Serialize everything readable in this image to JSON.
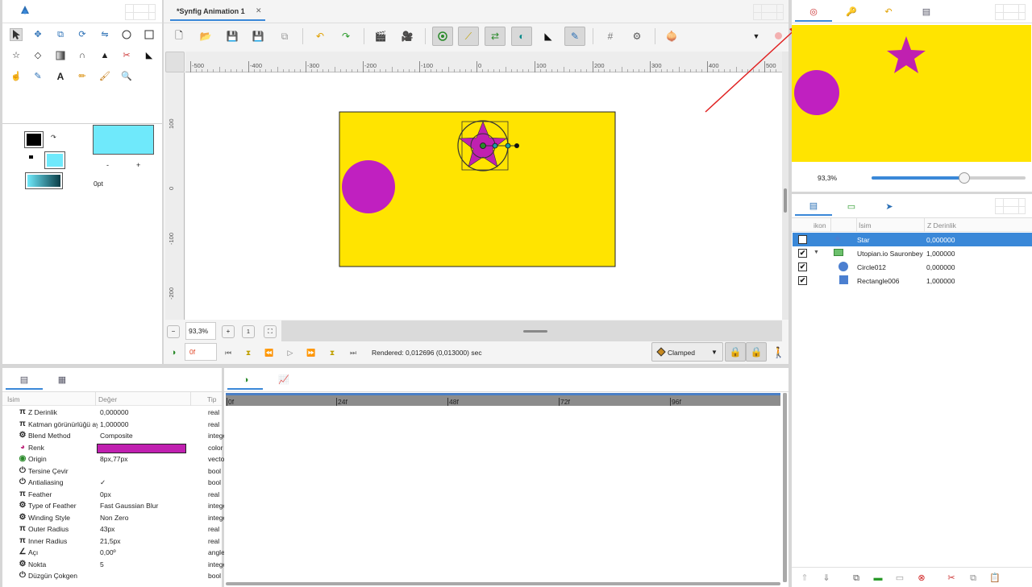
{
  "toolbox": {
    "tools": [
      "transform-tool",
      "smooth-move-tool",
      "scale-tool",
      "rotate-tool",
      "mirror-tool",
      "circle-tool",
      "rectangle-tool",
      "star-tool",
      "polygon-tool",
      "gradient-tool",
      "spline-tool",
      "fill-tool",
      "cutout-tool",
      "width-tool",
      "bone-tool",
      "eyedrop-tool",
      "text-tool",
      "sketch-tool",
      "brush-tool",
      "zoom-tool"
    ],
    "brush_size": "0pt",
    "outline_color": "#000000",
    "fill_color": "#6fe9fb",
    "minus": "-",
    "plus": "+"
  },
  "document": {
    "tab_title": "*Synfig Animation 1",
    "close_glyph": "✕"
  },
  "ruler": {
    "h_labels": [
      "-500",
      "-400",
      "-300",
      "-200",
      "-100",
      "0",
      "100",
      "200",
      "300",
      "400",
      "500"
    ],
    "v_labels": [
      "100",
      "0",
      "-100",
      "-200"
    ]
  },
  "canvas": {
    "background": "#ffe400",
    "circle_color": "#c020c0",
    "star_color": "#c020b0",
    "zoom": "93,3%"
  },
  "timebar": {
    "current_frame": "0f",
    "render_status": "Rendered: 0,012696 (0,013000) sec",
    "interpolation": "Clamped"
  },
  "navigator": {
    "zoom": "93,3%",
    "zoom_fraction": 0.6
  },
  "layers": {
    "headers": {
      "icon": "ikon",
      "name": "İsim",
      "zdepth": "Z Derinlik"
    },
    "rows": [
      {
        "name": "Star",
        "z": "0,000000",
        "checked": "✔",
        "selected": true
      },
      {
        "name": "Utopian.io Sauronbey",
        "z": "1,000000",
        "checked": "✔",
        "expander": "▼"
      },
      {
        "name": "Circle012",
        "z": "0,000000",
        "checked": "✔"
      },
      {
        "name": "Rectangle006",
        "z": "1,000000",
        "checked": "✔"
      }
    ]
  },
  "params": {
    "headers": {
      "name": "İsim",
      "value": "Değer",
      "type": "Tip"
    },
    "rows": [
      {
        "icon": "π",
        "name": "Z Derinlik",
        "value": "0,000000",
        "type": "real"
      },
      {
        "icon": "π",
        "name": "Katman görünürlüğü ay",
        "value": "1,000000",
        "type": "real"
      },
      {
        "icon": "⚙",
        "name": "Blend Method",
        "value": "Composite",
        "type": "intege"
      },
      {
        "icon": "◕",
        "name": "Renk",
        "value": "",
        "type": "color",
        "swatch": "#c020b0"
      },
      {
        "icon": "◉",
        "name": "Origin",
        "value": "8px,77px",
        "type": "vecto"
      },
      {
        "icon": "⏻",
        "name": "Tersine Çevir",
        "value": "",
        "type": "bool"
      },
      {
        "icon": "⏻",
        "name": "Antialiasing",
        "value": "✓",
        "type": "bool"
      },
      {
        "icon": "π",
        "name": "Feather",
        "value": "0px",
        "type": "real"
      },
      {
        "icon": "⚙",
        "name": "Type of Feather",
        "value": "Fast Gaussian Blur",
        "type": "intege"
      },
      {
        "icon": "⚙",
        "name": "Winding Style",
        "value": "Non Zero",
        "type": "intege"
      },
      {
        "icon": "π",
        "name": "Outer Radius",
        "value": "43px",
        "type": "real"
      },
      {
        "icon": "π",
        "name": "Inner Radius",
        "value": "21,5px",
        "type": "real"
      },
      {
        "icon": "∠",
        "name": "Açı",
        "value": "0,00º",
        "type": "angle"
      },
      {
        "icon": "⚙",
        "name": "Nokta",
        "value": "5",
        "type": "intege"
      },
      {
        "icon": "⏻",
        "name": "Düzgün Çokgen",
        "value": "",
        "type": "bool"
      }
    ]
  },
  "timetrack": {
    "labels": [
      "0f",
      "24f",
      "48f",
      "72f",
      "96f"
    ]
  }
}
